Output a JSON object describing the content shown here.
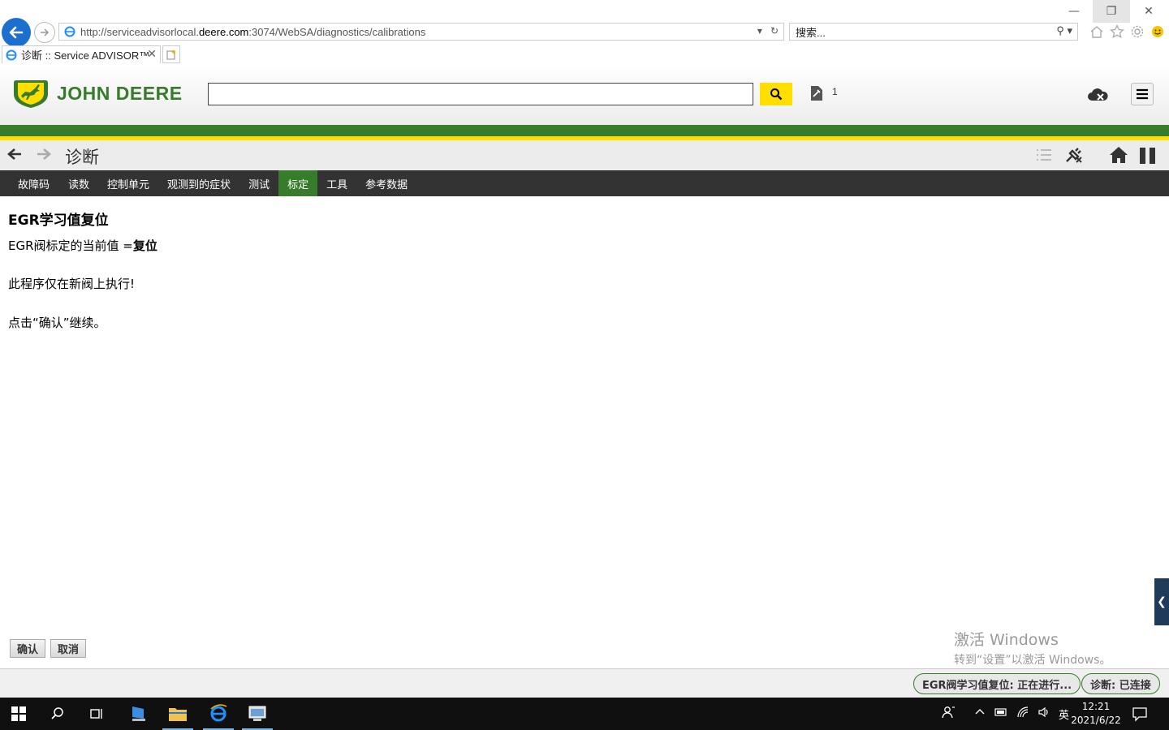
{
  "browser": {
    "url_prefix": "http://serviceadvisorlocal.",
    "url_host": "deere.com",
    "url_suffix": ":3074/WebSA/diagnostics/calibrations",
    "search_placeholder": "搜索...",
    "tab_title": "诊断 :: Service ADVISOR™"
  },
  "header": {
    "brand": "JOHN DEERE",
    "tools_count": "1"
  },
  "page": {
    "title": "诊断"
  },
  "tabs": [
    {
      "label": "故障码"
    },
    {
      "label": "读数"
    },
    {
      "label": "控制单元"
    },
    {
      "label": "观测到的症状"
    },
    {
      "label": "测试"
    },
    {
      "label": "标定",
      "active": true
    },
    {
      "label": "工具"
    },
    {
      "label": "参考数据"
    }
  ],
  "calibration": {
    "title": "EGR学习值复位",
    "value_label": "EGR阀标定的当前值 =",
    "value": "复位",
    "note": "此程序仅在新阀上执行!",
    "instruction": "点击“确认”继续。"
  },
  "actions": {
    "confirm": "确认",
    "cancel": "取消"
  },
  "watermark": {
    "line1": "激活 Windows",
    "line2": "转到“设置”以激活 Windows。"
  },
  "status": {
    "task": "EGR阀学习值复位: 正在进行...",
    "connection": "诊断: 已连接"
  },
  "taskbar": {
    "ime": "英",
    "time": "12:21",
    "date": "2021/6/22"
  },
  "colors": {
    "brand_green": "#367c2b",
    "brand_yellow": "#ffde00",
    "tab_bar": "#333333"
  }
}
